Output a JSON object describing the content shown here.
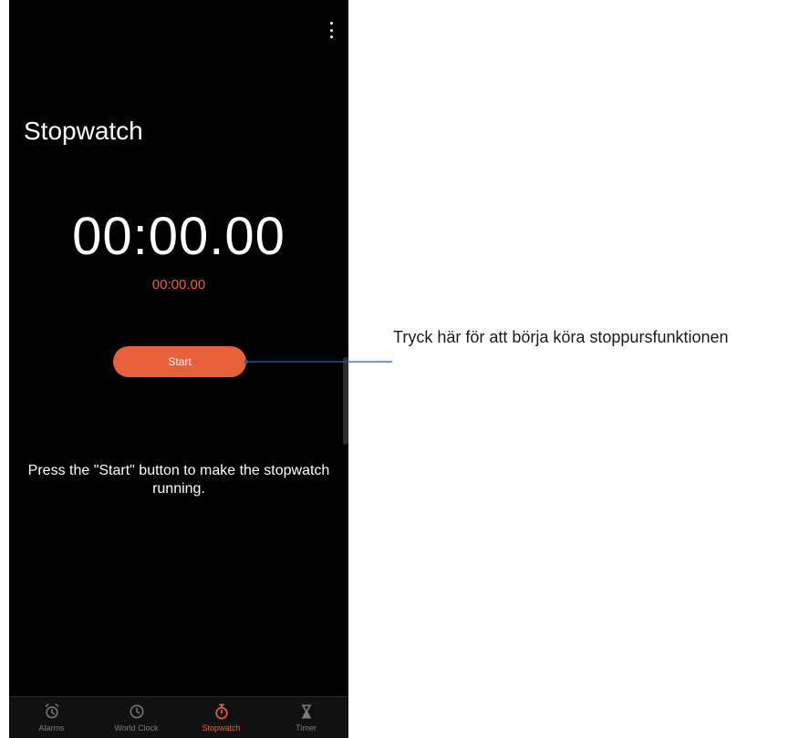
{
  "app": {
    "title": "Stopwatch",
    "main_time": "00:00.00",
    "lap_time": "00:00.00",
    "start_label": "Start",
    "hint": "Press the \"Start\" button to make the stopwatch running."
  },
  "nav": {
    "items": [
      {
        "label": "Alarms",
        "icon": "alarm-icon"
      },
      {
        "label": "World Clock",
        "icon": "clock-icon"
      },
      {
        "label": "Stopwatch",
        "icon": "stopwatch-icon"
      },
      {
        "label": "Timer",
        "icon": "hourglass-icon"
      }
    ],
    "active": "Stopwatch"
  },
  "callout": {
    "text": "Tryck här för att börja köra stoppursfunktionen"
  },
  "colors": {
    "accent": "#e8603a",
    "background": "#000000",
    "inactive": "#7a7a7a",
    "callout_line": "#1f5fa8"
  }
}
